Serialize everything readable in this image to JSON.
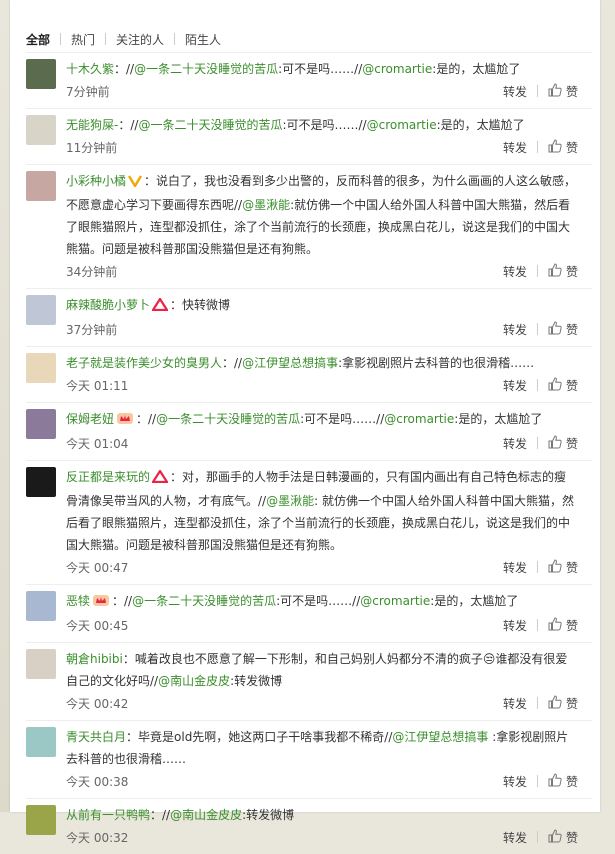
{
  "tabs": [
    "全部",
    "热门",
    "关注的人",
    "陌生人"
  ],
  "actions": {
    "forward": "转发",
    "like": "赞"
  },
  "comments": [
    {
      "author": "十木久紫",
      "badge": null,
      "parts": [
        {
          "t": "：//"
        },
        {
          "m": "@一条二十天没睡觉的苦瓜"
        },
        {
          "t": ":可不是吗……//"
        },
        {
          "m": "@cromartie"
        },
        {
          "t": ":是的，太尴尬了"
        }
      ],
      "time": "7分钟前"
    },
    {
      "author": "无能狗屎-",
      "badge": null,
      "parts": [
        {
          "t": "：//"
        },
        {
          "m": "@一条二十天没睡觉的苦瓜"
        },
        {
          "t": ":可不是吗……//"
        },
        {
          "m": "@cromartie"
        },
        {
          "t": ":是的，太尴尬了"
        }
      ],
      "time": "11分钟前"
    },
    {
      "author": "小彩种小橘",
      "badge": "v",
      "parts": [
        {
          "t": "：说白了，我也没看到多少出警的，反而科普的很多，为什么画画的人这么敏感，不愿意虚心学习下要画得东西呢//"
        },
        {
          "m": "@墨湫能"
        },
        {
          "t": ":就仿佛一个中国人给外国人科普中国大熊猫，然后看了眼熊猫照片，连型都没抓住，涂了个当前流行的长颈鹿，换成黑白花儿，说这是我们的中国大熊猫。问题是被科普那国没熊猫但是还有狗熊。"
        }
      ],
      "time": "34分钟前"
    },
    {
      "author": "麻辣酸脆小萝卜",
      "badge": "triangle",
      "parts": [
        {
          "t": "：快转微博"
        }
      ],
      "time": "37分钟前"
    },
    {
      "author": "老子就是装作美少女的臭男人",
      "badge": null,
      "parts": [
        {
          "t": "：//"
        },
        {
          "m": "@江伊望总想搞事"
        },
        {
          "t": ":拿影视剧照片去科普的也很滑稽……"
        }
      ],
      "time": "今天 01:11"
    },
    {
      "author": "保姆老妞",
      "badge": "crown",
      "parts": [
        {
          "t": "：//"
        },
        {
          "m": "@一条二十天没睡觉的苦瓜"
        },
        {
          "t": ":可不是吗……//"
        },
        {
          "m": "@cromartie"
        },
        {
          "t": ":是的，太尴尬了"
        }
      ],
      "time": "今天 01:04"
    },
    {
      "author": "反正都是来玩的",
      "badge": "triangle",
      "parts": [
        {
          "t": "：对，那画手的人物手法是日韩漫画的，只有国内画出有自己特色标志的瘦骨清像吴带当风的人物，才有底气。//"
        },
        {
          "m": "@墨湫能"
        },
        {
          "t": ": 就仿佛一个中国人给外国人科普中国大熊猫，然后看了眼熊猫照片，连型都没抓住，涂了个当前流行的长颈鹿，换成黑白花儿，说这是我们的中国大熊猫。问题是被科普那国没熊猫但是还有狗熊。"
        }
      ],
      "time": "今天 00:47"
    },
    {
      "author": "恶犊",
      "badge": "crown",
      "parts": [
        {
          "t": "：//"
        },
        {
          "m": "@一条二十天没睡觉的苦瓜"
        },
        {
          "t": ":可不是吗……//"
        },
        {
          "m": "@cromartie"
        },
        {
          "t": ":是的，太尴尬了"
        }
      ],
      "time": "今天 00:45"
    },
    {
      "author": "朝倉hibibi",
      "badge": null,
      "parts": [
        {
          "t": "：喊着改良也不愿意了解一下形制，和自己妈别人妈都分不清的疯子😒谁都没有很爱自己的文化好吗//"
        },
        {
          "m": "@南山金皮皮"
        },
        {
          "t": ":转发微博"
        }
      ],
      "time": "今天 00:42"
    },
    {
      "author": "青天共白月",
      "badge": null,
      "parts": [
        {
          "t": "：毕竟是old先啊，她这两口子干啥事我都不稀奇//"
        },
        {
          "m": "@江伊望总想搞事"
        },
        {
          "t": " :拿影视剧照片去科普的也很滑稽……"
        }
      ],
      "time": "今天 00:38"
    },
    {
      "author": "从前有一只鸭鸭",
      "badge": null,
      "parts": [
        {
          "t": "：//"
        },
        {
          "m": "@南山金皮皮"
        },
        {
          "t": ":转发微博"
        }
      ],
      "time": "今天 00:32"
    }
  ],
  "colors": {
    "name": "#3b8e2d",
    "badge_v": "#f0a700",
    "badge_red": "#e24"
  }
}
